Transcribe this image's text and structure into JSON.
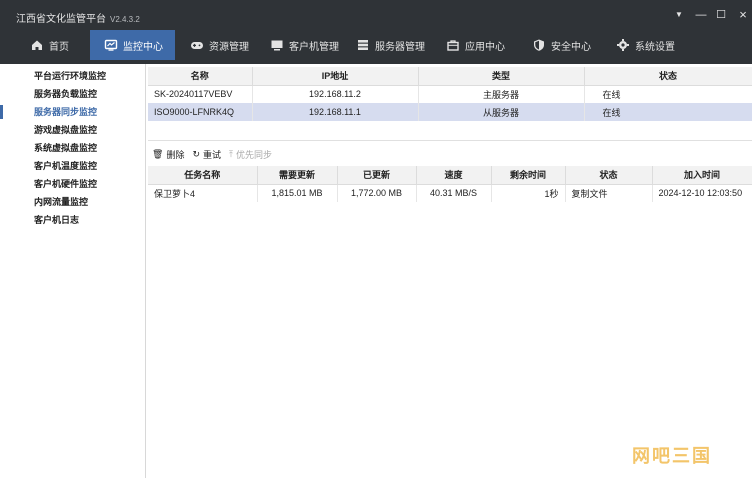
{
  "app": {
    "title": "江西省文化监管平台",
    "version": "V2.4.3.2"
  },
  "window_controls": {
    "menu": "▼",
    "minimize": "—",
    "maximize": "☐",
    "close": "×"
  },
  "nav": {
    "items": [
      {
        "label": "首页",
        "icon": "home-icon"
      },
      {
        "label": "监控中心",
        "icon": "monitor-icon",
        "active": true
      },
      {
        "label": "资源管理",
        "icon": "gamepad-icon"
      },
      {
        "label": "客户机管理",
        "icon": "computer-icon"
      },
      {
        "label": "服务器管理",
        "icon": "server-icon"
      },
      {
        "label": "应用中心",
        "icon": "bag-icon"
      },
      {
        "label": "安全中心",
        "icon": "shield-icon"
      },
      {
        "label": "系统设置",
        "icon": "gear-icon"
      }
    ]
  },
  "sidebar": {
    "items": [
      {
        "label": "平台运行环境监控"
      },
      {
        "label": "服务器负载监控"
      },
      {
        "label": "服务器同步监控",
        "active": true
      },
      {
        "label": "游戏虚拟盘监控"
      },
      {
        "label": "系统虚拟盘监控"
      },
      {
        "label": "客户机温度监控"
      },
      {
        "label": "客户机硬件监控"
      },
      {
        "label": "内网流量监控"
      },
      {
        "label": "客户机日志"
      }
    ]
  },
  "servers": {
    "columns": [
      "名称",
      "IP地址",
      "类型",
      "状态"
    ],
    "rows": [
      {
        "name": "SK-20240117VEBV",
        "ip": "192.168.11.2",
        "type": "主服务器",
        "status": "在线",
        "selected": false
      },
      {
        "name": "ISO9000-LFNRK4Q",
        "ip": "192.168.11.1",
        "type": "从服务器",
        "status": "在线",
        "selected": true
      }
    ]
  },
  "toolbar": {
    "delete_label": "删除",
    "retry_label": "重试",
    "priority_label": "优先同步"
  },
  "tasks": {
    "columns": [
      "任务名称",
      "需要更新",
      "已更新",
      "速度",
      "剩余时间",
      "状态",
      "加入时间"
    ],
    "rows": [
      {
        "name": "保卫萝卜4",
        "need": "1,815.01 MB",
        "done": "1,772.00 MB",
        "speed": "40.31 MB/S",
        "remain": "1秒",
        "state": "复制文件",
        "time": "2024-12-10 12:03:50"
      }
    ]
  },
  "watermark": "网吧三国",
  "colors": {
    "topbar": "#2f3337",
    "accent": "#3e6aa8",
    "selected_row": "#d6dcef",
    "watermark": "#f3c56a"
  }
}
